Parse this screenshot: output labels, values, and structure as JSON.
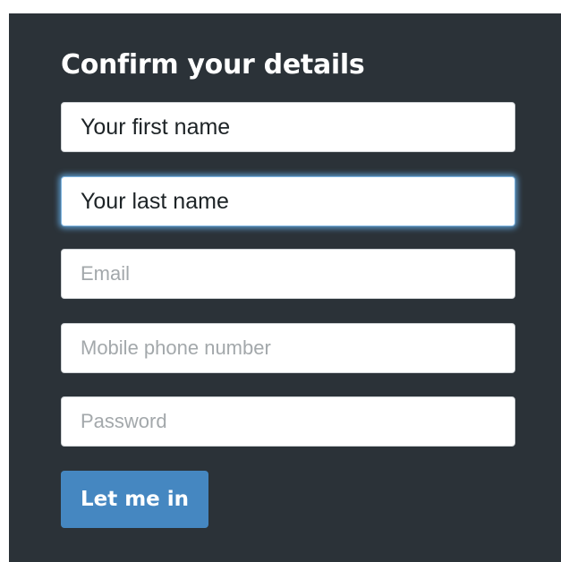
{
  "form": {
    "title": "Confirm your details",
    "fields": {
      "first_name": {
        "value": "Your first name",
        "placeholder": ""
      },
      "last_name": {
        "value": "Your last name",
        "placeholder": ""
      },
      "email": {
        "value": "",
        "placeholder": "Email"
      },
      "mobile": {
        "value": "",
        "placeholder": "Mobile phone number"
      },
      "password": {
        "value": "",
        "placeholder": "Password"
      }
    },
    "submit_label": "Let me in"
  },
  "colors": {
    "panel_background": "#2b3238",
    "button_background": "#4587c1",
    "focus_glow": "#66afe9"
  }
}
